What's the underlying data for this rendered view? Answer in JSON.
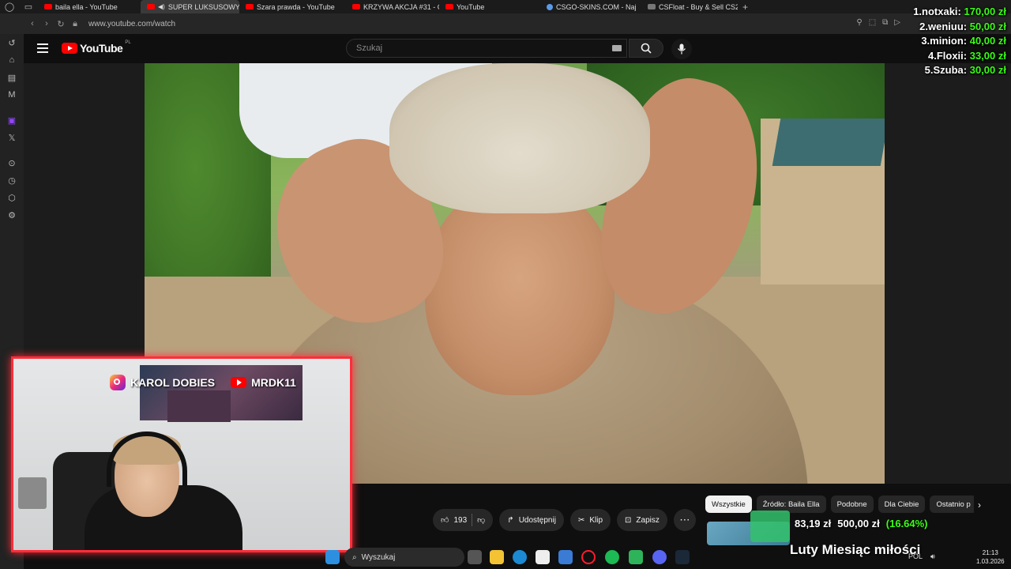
{
  "browser": {
    "tabs": [
      {
        "label": "baila ella - YouTube",
        "icon": "youtube-favicon"
      },
      {
        "label": "SUPER LUKSUSOWY",
        "icon": "youtube-favicon",
        "active": true
      },
      {
        "label": "Szara prawda - YouTube",
        "icon": "youtube-favicon"
      },
      {
        "label": "KRZYWA AKCJA #31 - CZ",
        "icon": "youtube-favicon"
      },
      {
        "label": "YouTube",
        "icon": "youtube-favicon"
      },
      {
        "label": "CSGO-SKINS.COM - Naj",
        "icon": "csgo-favicon"
      },
      {
        "label": "CSFloat - Buy & Sell CS2 S",
        "icon": "csfloat-favicon"
      }
    ],
    "new_tab": "+",
    "url": "www.youtube.com/watch"
  },
  "youtube": {
    "logo_text": "YouTube",
    "logo_region": "PL",
    "search_placeholder": "Szukaj"
  },
  "leaderboard": [
    {
      "name": "1.notxaki:",
      "amount": "170,00 zł"
    },
    {
      "name": "2.weniuu:",
      "amount": "50,00 zł"
    },
    {
      "name": "3.minion:",
      "amount": "40,00 zł"
    },
    {
      "name": "4.Floxii:",
      "amount": "33,00 zł"
    },
    {
      "name": "5.Szuba:",
      "amount": "30,00 zł"
    }
  ],
  "actions": {
    "like_count": "193",
    "share": "Udostępnij",
    "clip": "Klip",
    "save": "Zapisz",
    "more": "⋯"
  },
  "chips": [
    "Wszystkie",
    "Źródło: Baila Ella",
    "Podobne",
    "Dla Ciebie",
    "Ostatnio p"
  ],
  "goal": {
    "current": "83,19 zł",
    "target": "500,00 zł",
    "percent": "(16.64%)",
    "progress_fraction": 0.1664
  },
  "month_title": "Luty Miesiąc miłości",
  "webcam": {
    "instagram_handle": "KAROL DOBIES",
    "youtube_handle": "MRDK11"
  },
  "taskbar": {
    "search_label": "Wyszukaj",
    "lang": "POL",
    "time": "21:13",
    "date": "1.03.2026"
  },
  "colors": {
    "accent_red": "#ff0000",
    "webcam_border": "#ff2d3a",
    "donation_green": "#39ff14",
    "background": "#0f0f0f"
  }
}
